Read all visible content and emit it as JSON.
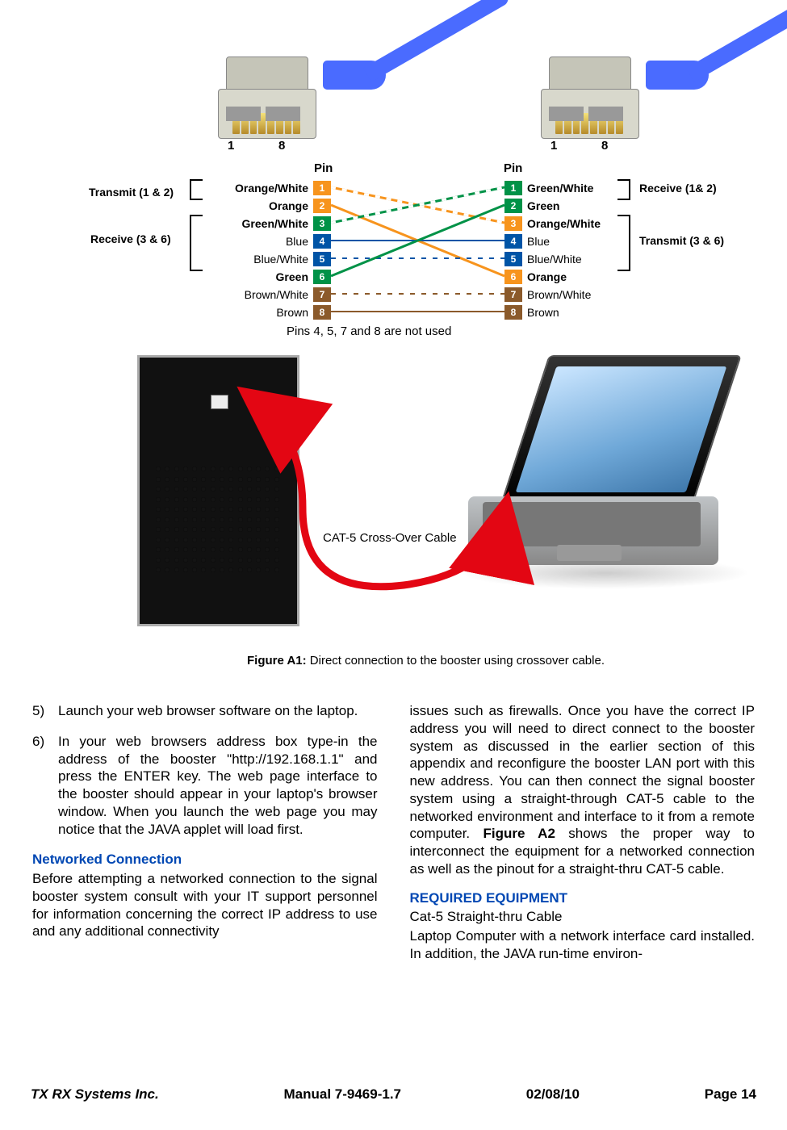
{
  "connectors": {
    "left1": "1",
    "left8": "8",
    "right1": "1",
    "right8": "8"
  },
  "pinout": {
    "header_left": "Pin",
    "header_right": "Pin",
    "side_left_top": "Transmit (1 & 2)",
    "side_left_bottom": "Receive (3 & 6)",
    "side_right_top": "Receive (1& 2)",
    "side_right_bottom": "Transmit (3 & 6)",
    "rows_left": [
      {
        "n": "1",
        "label": "Orange/White",
        "bold": true,
        "bg": "#f7941d"
      },
      {
        "n": "2",
        "label": "Orange",
        "bold": true,
        "bg": "#f7941d"
      },
      {
        "n": "3",
        "label": "Green/White",
        "bold": true,
        "bg": "#009247"
      },
      {
        "n": "4",
        "label": "Blue",
        "bold": false,
        "bg": "#0054a6"
      },
      {
        "n": "5",
        "label": "Blue/White",
        "bold": false,
        "bg": "#0054a6"
      },
      {
        "n": "6",
        "label": "Green",
        "bold": true,
        "bg": "#009247"
      },
      {
        "n": "7",
        "label": "Brown/White",
        "bold": false,
        "bg": "#8b5a2b"
      },
      {
        "n": "8",
        "label": "Brown",
        "bold": false,
        "bg": "#8b5a2b"
      }
    ],
    "rows_right": [
      {
        "n": "1",
        "label": "Green/White",
        "bold": true,
        "bg": "#009247"
      },
      {
        "n": "2",
        "label": "Green",
        "bold": true,
        "bg": "#009247"
      },
      {
        "n": "3",
        "label": "Orange/White",
        "bold": true,
        "bg": "#f7941d"
      },
      {
        "n": "4",
        "label": "Blue",
        "bold": false,
        "bg": "#0054a6"
      },
      {
        "n": "5",
        "label": "Blue/White",
        "bold": false,
        "bg": "#0054a6"
      },
      {
        "n": "6",
        "label": "Orange",
        "bold": true,
        "bg": "#f7941d"
      },
      {
        "n": "7",
        "label": "Brown/White",
        "bold": false,
        "bg": "#8b5a2b"
      },
      {
        "n": "8",
        "label": "Brown",
        "bold": false,
        "bg": "#8b5a2b"
      }
    ],
    "note": "Pins 4, 5, 7 and 8 are not used"
  },
  "devices": {
    "cat5_label": "CAT-5 Cross-Over Cable"
  },
  "figure_caption_bold": "Figure A1:",
  "figure_caption_rest": " Direct connection to the booster using crossover cable.",
  "body": {
    "item5_num": "5)",
    "item5": "Launch your web browser software on the lap­top.",
    "item6_num": "6)",
    "item6": "In your web browsers address box type-in the address of the booster \"http://192.168.1.1\" and press the ENTER key. The web page interface to the booster should appear in your laptop's browser window. When you launch the web page you may notice that the JAVA applet will load first.",
    "sub1": "Networked Connection",
    "para1a": "Before attempting a networked connection to the signal booster system consult with your IT support personnel for information concerning the correct IP address to use and any additional connectivity",
    "para1b_pre": "issues such as firewalls. Once you have the correct IP address you will need to direct connect to the booster system as discussed in the earlier section of this appendix and reconfigure the booster LAN port with this new address. You can then connect the signal booster system using a straight-through CAT-5 cable to the networked environment and interface to it from a remote computer. ",
    "para1b_bold": "Figure A2",
    "para1b_post": " shows the proper way to interconnect the equip­ment for a networked connection as well as the pinout for a straight-thru CAT-5 cable.",
    "sub2": "REQUIRED EQUIPMENT",
    "para2": "Cat-5 Straight-thru Cable",
    "para3": "Laptop Computer with a network interface card installed. In addition, the JAVA run-time environ-"
  },
  "footer": {
    "company": "TX RX Systems Inc.",
    "manual": "Manual 7-9469-1.7",
    "date": "02/08/10",
    "page": "Page 14"
  }
}
